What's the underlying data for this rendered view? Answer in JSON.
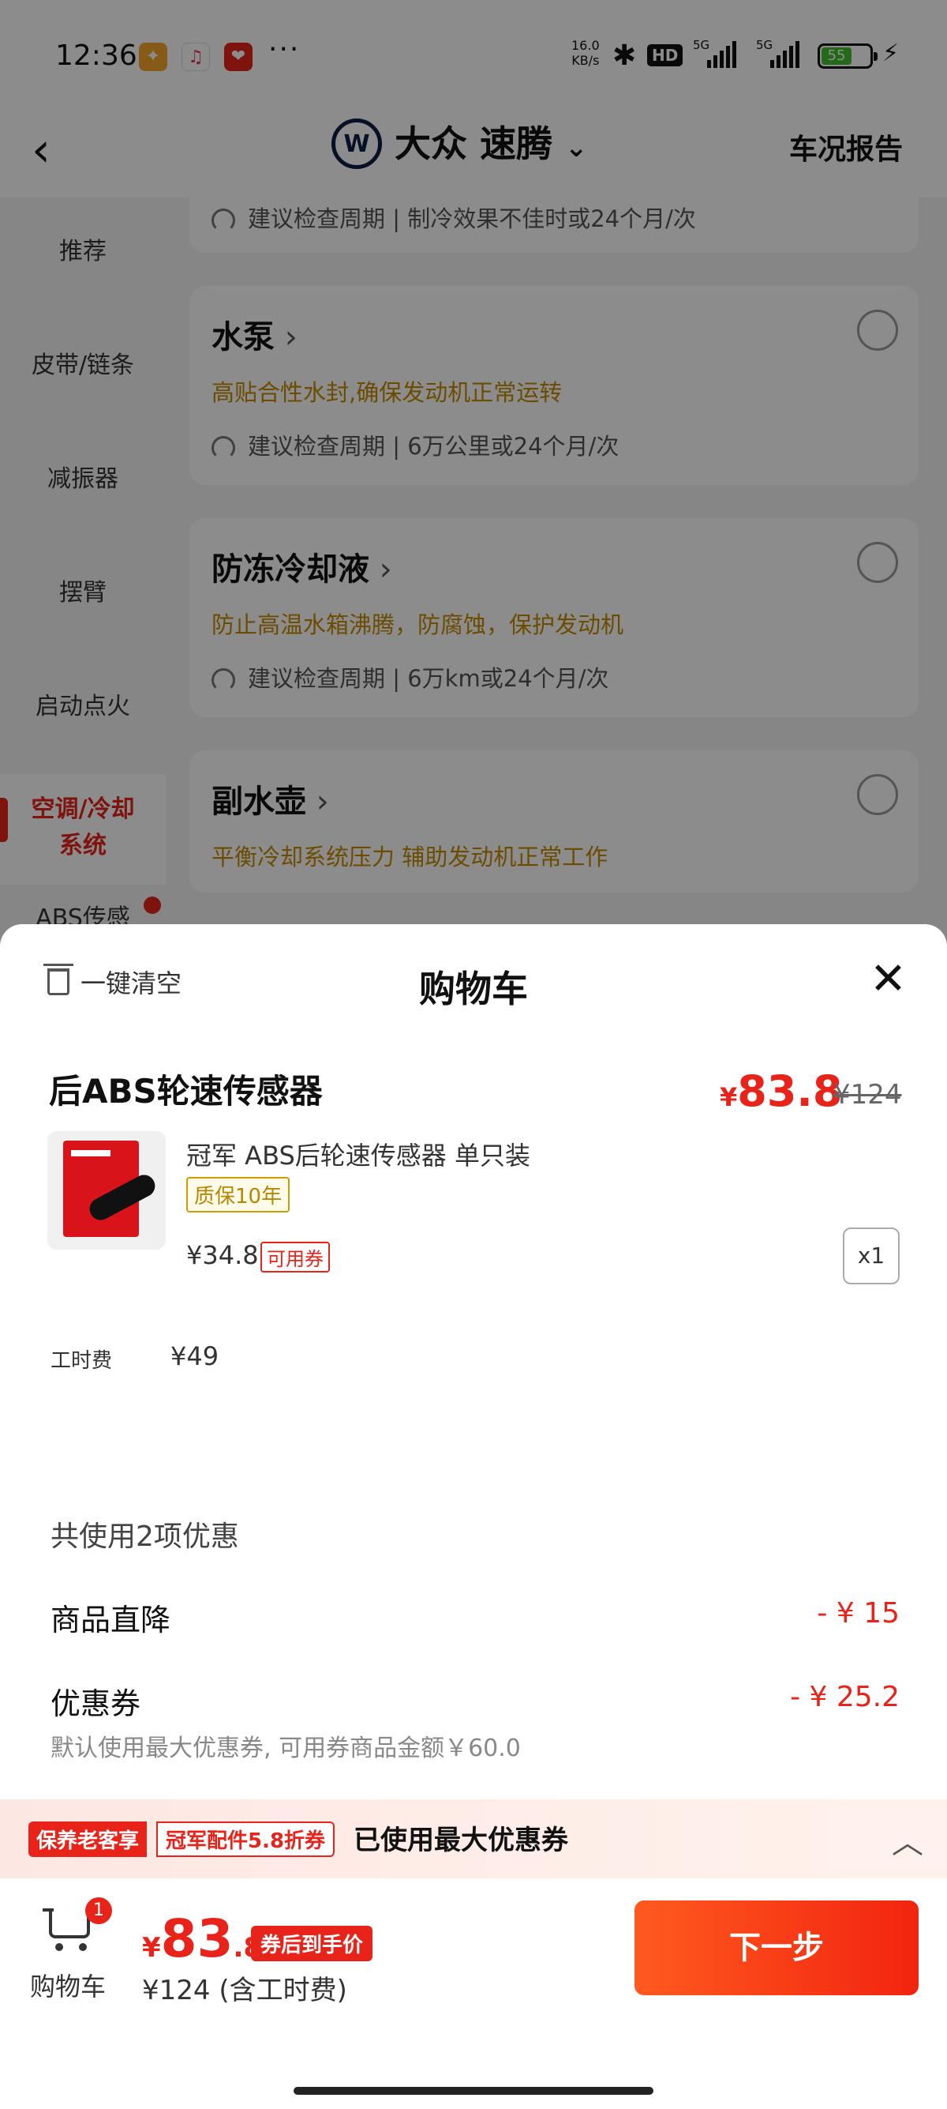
{
  "status_bar": {
    "time": "12:36",
    "net_speed_value": "16.0",
    "net_speed_unit": "KB/s",
    "hd_badge": "HD",
    "net_type_1": "5G",
    "net_type_2": "5G",
    "battery": "55",
    "more": "···"
  },
  "header": {
    "back_icon": "chevron-left",
    "brand_logo": "W",
    "title": "大众 速腾",
    "title_dropdown": "chevron-down",
    "report_label": "车况报告"
  },
  "sidebar": {
    "items": [
      {
        "label": "推荐"
      },
      {
        "label": "皮带/链条"
      },
      {
        "label": "减振器"
      },
      {
        "label": "摆臂"
      },
      {
        "label": "启动点火"
      },
      {
        "label": "空调/冷却系统",
        "line1": "空调/冷却",
        "line2": "系统",
        "active": true
      },
      {
        "label": "ABS传感"
      }
    ]
  },
  "parts": [
    {
      "cycle": "建议检查周期 | 制冷效果不佳时或24个月/次"
    },
    {
      "name": "水泵",
      "desc": "高贴合性水封,确保发动机正常运转",
      "cycle": "建议检查周期 | 6万公里或24个月/次"
    },
    {
      "name": "防冻冷却液",
      "desc": "防止高温水箱沸腾，防腐蚀，保护发动机",
      "cycle": "建议检查周期 | 6万km或24个月/次"
    },
    {
      "name": "副水壶",
      "desc": "平衡冷却系统压力 辅助发动机正常工作"
    }
  ],
  "cart_sheet": {
    "clear_label": "一键清空",
    "title": "购物车",
    "close_icon": "close-x",
    "product": {
      "name": "后ABS轮速传感器",
      "price_currency": "¥",
      "price": "83.8",
      "original_price": "¥124",
      "sub_name": "冠军 ABS后轮速传感器 单只装",
      "warranty": "质保10年",
      "unit_price": "¥34.8",
      "coupon_tag": "可用券",
      "quantity": "x1",
      "labor_label": "工时费",
      "labor_price": "¥49"
    },
    "discount": {
      "summary": "共使用2项优惠",
      "rows": [
        {
          "label": "商品直降",
          "value": "- ¥ 15"
        },
        {
          "label": "优惠券",
          "value": "- ¥ 25.2"
        }
      ],
      "note": "默认使用最大优惠券, 可用券商品金额￥60.0"
    },
    "promo": {
      "tag1": "保养老客享",
      "tag2": "冠军配件5.8折券",
      "text": "已使用最大优惠券",
      "chevron_icon": "chevron-up"
    },
    "footer": {
      "cart_label": "购物车",
      "cart_count": "1",
      "total_currency": "¥",
      "total_int": "83",
      "total_dec": ".8",
      "after_coupon": "券后到手价",
      "total_full": "¥124 (含工时费)",
      "next_label": "下一步"
    }
  },
  "colors": {
    "accent": "#e8231a",
    "gold": "#c58a00",
    "brand_blue": "#0b1e45"
  }
}
